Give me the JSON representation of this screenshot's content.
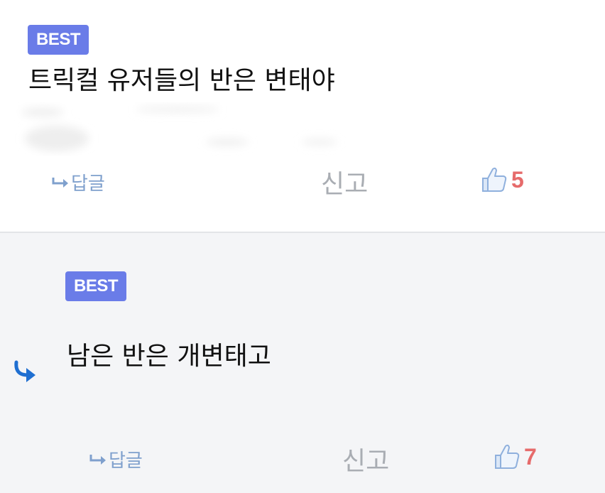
{
  "comments": [
    {
      "badge": "BEST",
      "text": "트릭컬 유저들의 반은 변태야",
      "reply_label": "답글",
      "report_label": "신고",
      "likes": "5"
    },
    {
      "badge": "BEST",
      "text": "남은 반은 개변태고",
      "reply_label": "답글",
      "report_label": "신고",
      "likes": "7"
    }
  ],
  "colors": {
    "badge_bg": "#6a7ce8",
    "like_count": "#e66b6b",
    "reply_link": "#7fa0cd",
    "nested_arrow": "#1f6fd1",
    "nested_bg": "#f4f5f7"
  },
  "icons": {
    "reply": "reply-arrow-icon",
    "like": "thumbs-up-icon",
    "nested": "nested-reply-arrow-icon"
  }
}
